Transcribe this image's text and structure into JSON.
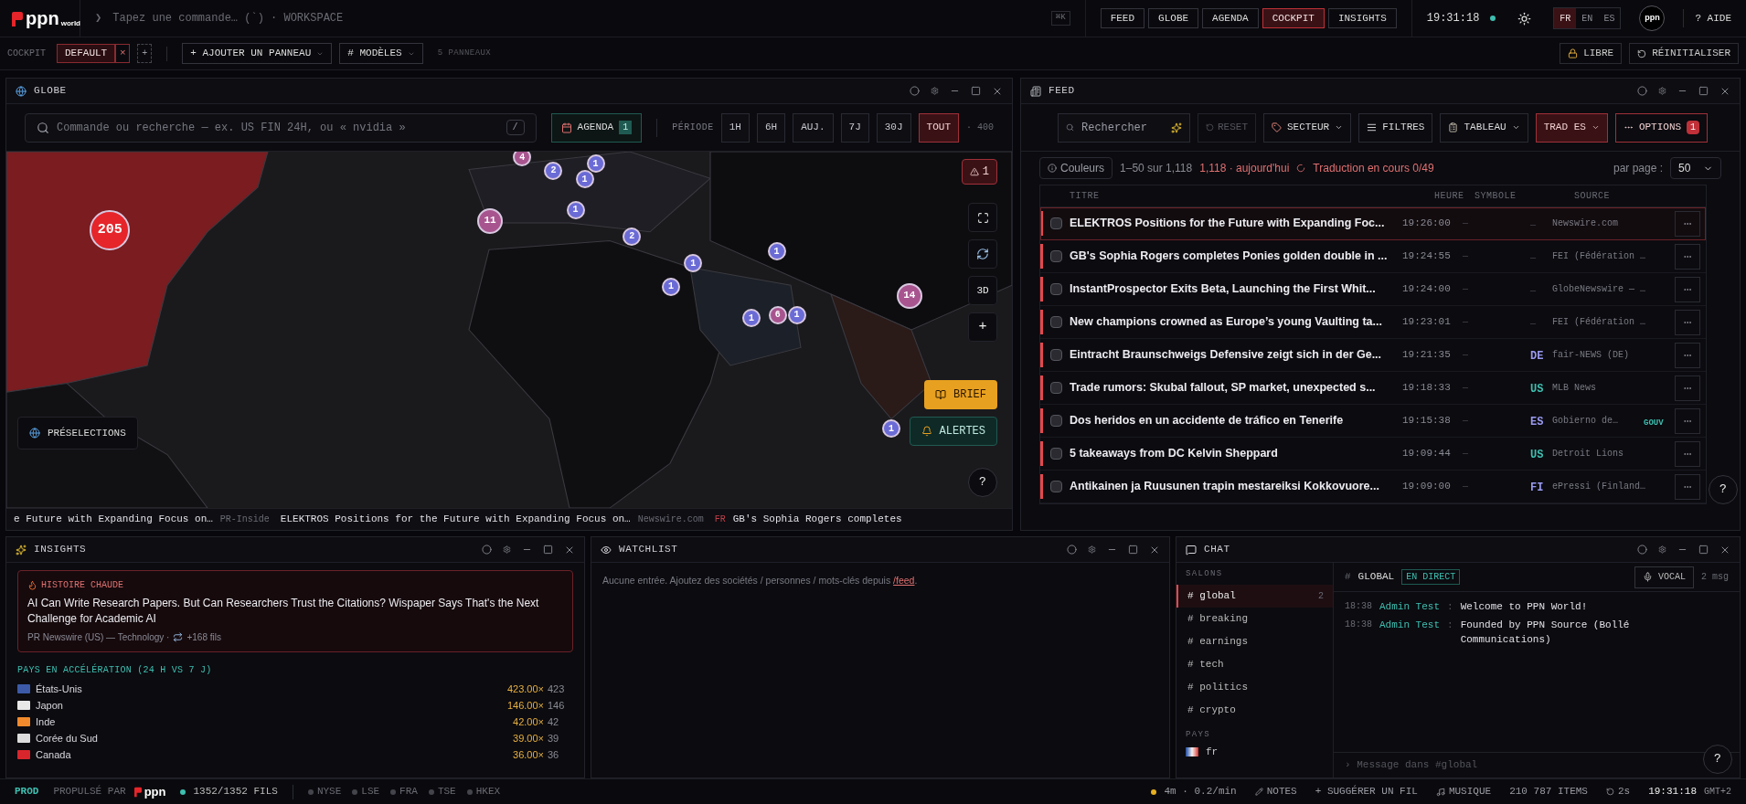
{
  "topbar": {
    "logo": "ppn",
    "logo_sub": "world",
    "command_prompt": "❯",
    "command_placeholder": "Tapez une commande… (`) · WORKSPACE",
    "shortcut": "⌘K",
    "nav": [
      {
        "label": "FEED",
        "selected": false
      },
      {
        "label": "GLOBE",
        "selected": false
      },
      {
        "label": "AGENDA",
        "selected": false
      },
      {
        "label": "COCKPIT",
        "selected": true
      },
      {
        "label": "INSIGHTS",
        "selected": false
      }
    ],
    "clock": "19:31:18",
    "clock_live": true,
    "languages": [
      {
        "label": "FR",
        "selected": true
      },
      {
        "label": "EN",
        "selected": false
      },
      {
        "label": "ES",
        "selected": false
      }
    ],
    "avatar": "ppn",
    "help": "? AIDE"
  },
  "workspace_bar": {
    "label": "COCKPIT",
    "tabs": [
      {
        "label": "DEFAULT",
        "selected": true
      }
    ],
    "close": "×",
    "add": "+",
    "add_panel": "+ AJOUTER UN PANNEAU",
    "models": "# MODÈLES",
    "panel_count": "5 PANNEAUX",
    "lock": "LIBRE",
    "reset": "RÉINITIALISER"
  },
  "globe": {
    "title": "GLOBE",
    "search_placeholder": "Commande ou recherche — ex. US FIN 24H, ou « nvidia »",
    "search_key": "/",
    "agenda": "AGENDA",
    "agenda_count": "1",
    "period_label": "PÉRIODE",
    "periods": [
      {
        "label": "1H",
        "selected": false
      },
      {
        "label": "6H",
        "selected": false
      },
      {
        "label": "AUJ.",
        "selected": false
      },
      {
        "label": "7J",
        "selected": false
      },
      {
        "label": "30J",
        "selected": false
      },
      {
        "label": "TOUT",
        "selected": true
      }
    ],
    "total": "· 400",
    "markers": [
      {
        "count": "205",
        "color": "#e5252a"
      },
      {
        "count": "4",
        "color": "#a8558f"
      },
      {
        "count": "2",
        "color": "#6b6bd6"
      },
      {
        "count": "1",
        "color": "#6b6bd6"
      },
      {
        "count": "1",
        "color": "#6b6bd6"
      },
      {
        "count": "11",
        "color": "#a8558f"
      },
      {
        "count": "1",
        "color": "#6b6bd6"
      },
      {
        "count": "2",
        "color": "#6b6bd6"
      },
      {
        "count": "1",
        "color": "#6b6bd6"
      },
      {
        "count": "1",
        "color": "#6b6bd6"
      },
      {
        "count": "1",
        "color": "#6b6bd6"
      },
      {
        "count": "1",
        "color": "#6b6bd6"
      },
      {
        "count": "6",
        "color": "#a8558f"
      },
      {
        "count": "1",
        "color": "#6b6bd6"
      },
      {
        "count": "14",
        "color": "#a8558f"
      },
      {
        "count": "1",
        "color": "#6b6bd6"
      }
    ],
    "alert_count": "1",
    "view_3d": "3D",
    "zoom_in": "+",
    "brief": "BRIEF",
    "alerts": "ALERTES",
    "help": "?",
    "presets": "PRÉSELECTIONS",
    "ticker": [
      {
        "title": "e Future with Expanding Focus on…",
        "source": "PR-Inside"
      },
      {
        "title": "ELEKTROS Positions for the Future with Expanding Focus on…",
        "source": "Newswire.com"
      },
      {
        "lang": "FR",
        "title": "GB's Sophia Rogers completes"
      }
    ]
  },
  "feed": {
    "title": "FEED",
    "search_placeholder": "Rechercher",
    "reset": "RESET",
    "sector": "SECTEUR",
    "filters": "FILTRES",
    "table": "TABLEAU",
    "translate": "TRAD ES",
    "options": "OPTIONS",
    "options_count": "1",
    "colors": "Couleurs",
    "range": "1–50 sur 1,118",
    "today": "1,118 · aujourd'hui",
    "translation": "Traduction en cours 0/49",
    "per_page_label": "par page :",
    "per_page": "50",
    "columns": [
      "TITRE",
      "HEURE",
      "SYMBOLE",
      "SOURCE"
    ],
    "rows": [
      {
        "title": "ELEKTROS Positions for the Future with Expanding Foc...",
        "time": "19:26:00",
        "symbol": "—",
        "lang": "—",
        "source": "Newswire.com",
        "selected": true,
        "checked": false
      },
      {
        "title": "GB's Sophia Rogers completes Ponies golden double in ...",
        "time": "19:24:55",
        "symbol": "—",
        "lang": "—",
        "source": "FEI (Fédération …",
        "selected": false,
        "checked": false
      },
      {
        "title": "InstantProspector Exits Beta, Launching the First Whit...",
        "time": "19:24:00",
        "symbol": "—",
        "lang": "—",
        "source": "GlobeNewswire — …",
        "selected": false,
        "checked": false
      },
      {
        "title": "New champions crowned as Europe’s young Vaulting ta...",
        "time": "19:23:01",
        "symbol": "—",
        "lang": "—",
        "source": "FEI (Fédération …",
        "selected": false,
        "checked": false
      },
      {
        "title": "Eintracht Braunschweigs Defensive zeigt sich in der Ge...",
        "time": "19:21:35",
        "symbol": "—",
        "lang": "DE",
        "color": "#9a9af0",
        "source": "fair-NEWS (DE)",
        "selected": false,
        "checked": false
      },
      {
        "title": "Trade rumors: Skubal fallout, SP market, unexpected s...",
        "time": "19:18:33",
        "symbol": "—",
        "lang": "US",
        "color": "#3fbfb0",
        "source": "MLB News",
        "selected": false,
        "checked": false
      },
      {
        "title": "Dos heridos en un accidente de tráfico en Tenerife",
        "time": "19:15:38",
        "symbol": "—",
        "lang": "ES",
        "color": "#9a9af0",
        "source": "Gobierno de…",
        "tag": "GOUV",
        "selected": false,
        "checked": false
      },
      {
        "title": "5 takeaways from DC Kelvin Sheppard",
        "time": "19:09:44",
        "symbol": "—",
        "lang": "US",
        "color": "#3fbfb0",
        "source": "Detroit Lions",
        "selected": false,
        "checked": false
      },
      {
        "title": "Antikainen ja Ruusunen trapin mestareiksi Kokkovuore...",
        "time": "19:09:00",
        "symbol": "—",
        "lang": "FI",
        "color": "#9a9af0",
        "source": "ePressi (Finland…",
        "selected": false,
        "checked": false
      }
    ],
    "help": "?"
  },
  "insights": {
    "title": "INSIGHTS",
    "hot_label": "HISTOIRE CHAUDE",
    "hot_title": "AI Can Write Research Papers. But Can Researchers Trust the Citations? Wispaper Says That's the Next Challenge for Academic AI",
    "hot_meta": "PR Newswire (US) — Technology ·",
    "hot_threads": "+168 fils",
    "section": "PAYS EN ACCÉLÉRATION (24 H VS 7 J)",
    "countries": [
      {
        "name": "États-Unis",
        "ratio": "423.00×",
        "count": "423",
        "color": "#3c5aa8"
      },
      {
        "name": "Japon",
        "ratio": "146.00×",
        "count": "146",
        "color": "#e8e8e8"
      },
      {
        "name": "Inde",
        "ratio": "42.00×",
        "count": "42",
        "color": "#f08a2c"
      },
      {
        "name": "Corée du Sud",
        "ratio": "39.00×",
        "count": "39",
        "color": "#dcdcdc"
      },
      {
        "name": "Canada",
        "ratio": "36.00×",
        "count": "36",
        "color": "#d8262c"
      }
    ]
  },
  "watchlist": {
    "title": "WATCHLIST",
    "empty_text": "Aucune entrée. Ajoutez des sociétés / personnes / mots-clés depuis",
    "empty_link": "/feed",
    "empty_end": "."
  },
  "chat": {
    "title": "CHAT",
    "rooms_label": "SALONS",
    "rooms": [
      {
        "label": "# global",
        "count": "2",
        "selected": true
      },
      {
        "label": "# breaking",
        "selected": false
      },
      {
        "label": "# earnings",
        "selected": false
      },
      {
        "label": "# tech",
        "selected": false
      },
      {
        "label": "# politics",
        "selected": false
      },
      {
        "label": "# crypto",
        "selected": false
      }
    ],
    "countries_label": "PAYS",
    "countries": [
      {
        "label": "fr"
      }
    ],
    "channel_hash": "#",
    "channel": "GLOBAL",
    "live": "EN DIRECT",
    "voice": "VOCAL",
    "message_count": "2 msg",
    "messages": [
      {
        "time": "18:38",
        "author": "Admin Test",
        "sep": ":",
        "text": "Welcome to PPN World!"
      },
      {
        "time": "18:38",
        "author": "Admin Test",
        "sep": ":",
        "text": "Founded by PPN Source (Bollé Communications)"
      }
    ],
    "input_placeholder": "› Message dans #global",
    "help": "?"
  },
  "status_bar": {
    "env": "PROD",
    "powered_by": "PROPULSÉ PAR",
    "logo": "ppn",
    "threads": "1352/1352 FILS",
    "markets": [
      {
        "label": "NYSE",
        "open": false
      },
      {
        "label": "LSE",
        "open": false
      },
      {
        "label": "FRA",
        "open": false
      },
      {
        "label": "TSE",
        "open": false
      },
      {
        "label": "HKEX",
        "open": false
      }
    ],
    "rate": "4m · 0.2/min",
    "notes": "NOTES",
    "suggest": "+ SUGGÉRER UN FIL",
    "music": "MUSIQUE",
    "items": "210 787 ITEMS",
    "refresh": "2s",
    "clock": "19:31:18",
    "timezone": "GMT+2"
  }
}
